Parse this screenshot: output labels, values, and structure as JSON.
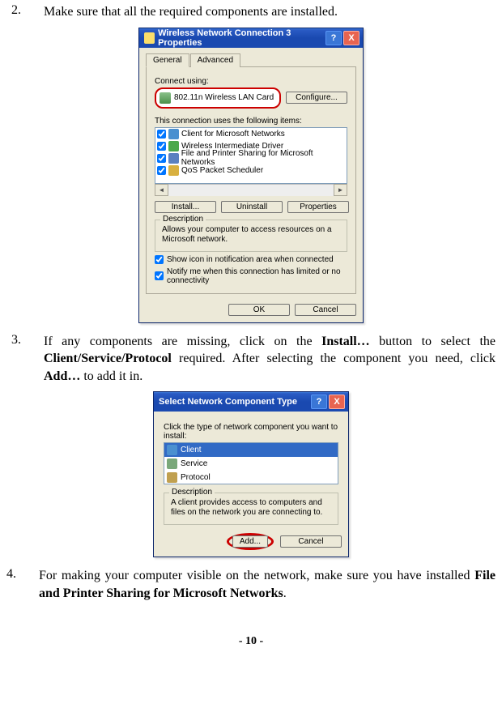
{
  "step2": {
    "num": "2.",
    "text": "Make sure that all the required components are installed."
  },
  "step3": {
    "num": "3.",
    "prefix": "If any components are missing, click on the ",
    "b1": "Install…",
    "mid1": " button to select the ",
    "b2": "Client/Service/Protocol",
    "mid2": " required. After selecting the component you need, click ",
    "b3": "Add…",
    "suffix": " to add it in."
  },
  "step4": {
    "num": "4.",
    "prefix": "For making your computer visible on the network, make sure you have installed ",
    "b1": "File and Printer Sharing for Microsoft Networks",
    "suffix": "."
  },
  "pageNum": "- 10 -",
  "dlg1": {
    "title": "Wireless Network Connection 3 Properties",
    "help": "?",
    "close": "X",
    "tabGeneral": "General",
    "tabAdvanced": "Advanced",
    "connectUsing": "Connect using:",
    "adapter": "802.11n Wireless LAN Card",
    "configure": "Configure...",
    "usesItems": "This connection uses the following items:",
    "items": [
      "Client for Microsoft Networks",
      "Wireless Intermediate Driver",
      "File and Printer Sharing for Microsoft Networks",
      "QoS Packet Scheduler"
    ],
    "install": "Install...",
    "uninstall": "Uninstall",
    "properties": "Properties",
    "descTitle": "Description",
    "descText": "Allows your computer to access resources on a Microsoft network.",
    "chk1": "Show icon in notification area when connected",
    "chk2": "Notify me when this connection has limited or no connectivity",
    "ok": "OK",
    "cancel": "Cancel"
  },
  "dlg2": {
    "title": "Select Network Component Type",
    "help": "?",
    "close": "X",
    "prompt": "Click the type of network component you want to install:",
    "client": "Client",
    "service": "Service",
    "protocol": "Protocol",
    "descTitle": "Description",
    "descText": "A client provides access to computers and files on the network you are connecting to.",
    "add": "Add...",
    "cancel": "Cancel"
  }
}
